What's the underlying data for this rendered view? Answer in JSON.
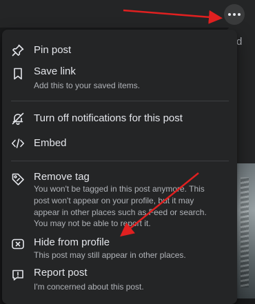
{
  "colors": {
    "menu_background": "#242526",
    "page_background": "#18191a",
    "primary_text": "#e4e6eb",
    "secondary_text": "#b0b3b8",
    "annotation_arrow": "#e02020"
  },
  "header": {
    "more_button_icon": "three-dots-icon",
    "partial_text": "d"
  },
  "menu": {
    "items": [
      {
        "icon": "pin-icon",
        "label": "Pin post",
        "description": ""
      },
      {
        "icon": "bookmark-icon",
        "label": "Save link",
        "description": "Add this to your saved items."
      },
      {
        "icon": "bell-off-icon",
        "label": "Turn off notifications for this post",
        "description": ""
      },
      {
        "icon": "code-icon",
        "label": "Embed",
        "description": ""
      },
      {
        "icon": "tag-remove-icon",
        "label": "Remove tag",
        "description": "You won't be tagged in this post anymore. This post won't appear on your profile, but it may appear in other places such as Feed or search. You may not be able to report it."
      },
      {
        "icon": "hide-x-icon",
        "label": "Hide from profile",
        "description": "This post may still appear in other places."
      },
      {
        "icon": "report-icon",
        "label": "Report post",
        "description": "I'm concerned about this post."
      }
    ]
  },
  "annotations": [
    {
      "name": "arrow-to-more-button",
      "target": "more-button"
    },
    {
      "name": "arrow-to-hide-from-profile",
      "target": "menu-item-hide-from-profile"
    }
  ]
}
